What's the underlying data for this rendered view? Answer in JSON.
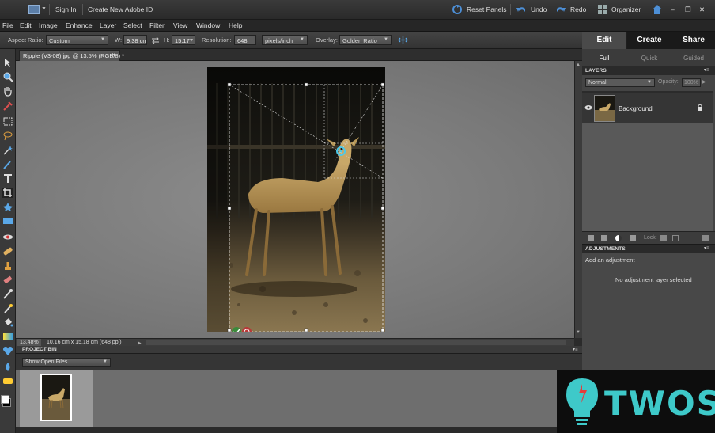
{
  "topbar": {
    "sign_in": "Sign In",
    "create_id": "Create New Adobe ID",
    "reset_panels": "Reset Panels",
    "undo": "Undo",
    "redo": "Redo",
    "organizer": "Organizer"
  },
  "menubar": [
    "File",
    "Edit",
    "Image",
    "Enhance",
    "Layer",
    "Select",
    "Filter",
    "View",
    "Window",
    "Help"
  ],
  "options": {
    "aspect_label": "Aspect Ratio:",
    "aspect_value": "Custom",
    "w_label": "W:",
    "w_value": "9.38 cm",
    "h_label": "H:",
    "h_value": "15.177 c",
    "res_label": "Resolution:",
    "res_value": "648",
    "res_unit": "pixels/inch",
    "overlay_label": "Overlay:",
    "overlay_value": "Golden Ratio"
  },
  "panel_tabs": {
    "main": [
      "Edit",
      "Create",
      "Share"
    ],
    "sub": [
      "Full",
      "Quick",
      "Guided"
    ]
  },
  "document": {
    "tab_title": "Ripple (V3-08).jpg @ 13.5% (RGB/8) *",
    "zoom": "13.48%",
    "doc_info": "10.16 cm x 15.18 cm (648 ppi)"
  },
  "project_bin": {
    "title": "PROJECT BIN",
    "show": "Show Open Files"
  },
  "layers": {
    "title": "LAYERS",
    "blend_mode": "Normal",
    "opacity_label": "Opacity:",
    "opacity_value": "100%",
    "layer_name": "Background",
    "lock_label": "Lock:"
  },
  "adjustments": {
    "title": "ADJUSTMENTS",
    "add": "Add an adjustment",
    "none": "No adjustment layer selected"
  },
  "watermark": {
    "brand": "TWOS"
  },
  "colors": {
    "accent_blue": "#4d8fd6",
    "watermark_cyan": "#3ec9c9"
  }
}
